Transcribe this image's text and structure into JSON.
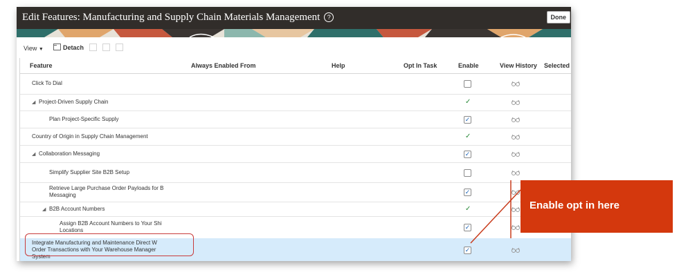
{
  "window": {
    "title": "Edit Features: Manufacturing and Supply Chain Materials Management",
    "help_glyph": "?",
    "done_label": "Done"
  },
  "toolbar": {
    "view_label": "View",
    "view_arrow": "▼",
    "detach_label": "Detach"
  },
  "columns": {
    "feature": "Feature",
    "always_enabled_from": "Always Enabled From",
    "help": "Help",
    "opt_in_task": "Opt In Task",
    "enable": "Enable",
    "view_history": "View History",
    "selected": "Selected C"
  },
  "rows": [
    {
      "label": "Click To Dial",
      "level": 0,
      "expander": "",
      "enable": "unchecked"
    },
    {
      "label": "Project-Driven Supply Chain",
      "level": 0,
      "expander": "◢",
      "enable": "tick"
    },
    {
      "label": "Plan Project-Specific Supply",
      "level": 1,
      "expander": "",
      "enable": "checked"
    },
    {
      "label": "Country of Origin in Supply Chain Management",
      "level": 0,
      "expander": "",
      "enable": "tick"
    },
    {
      "label": "Collaboration Messaging",
      "level": 0,
      "expander": "◢",
      "enable": "checked"
    },
    {
      "label": "Simplify Supplier Site B2B Setup",
      "level": 1,
      "expander": "",
      "enable": "unchecked"
    },
    {
      "label": "Retrieve Large Purchase Order Payloads for B\nMessaging",
      "level": 1,
      "expander": "",
      "enable": "checked"
    },
    {
      "label": "B2B Account Numbers",
      "level": 1,
      "expander": "◢",
      "enable": "tick"
    },
    {
      "label": "Assign B2B Account Numbers to Your Shi\nLocations",
      "level": 2,
      "expander": "",
      "enable": "checked"
    },
    {
      "label": "Integrate Manufacturing and Maintenance Direct W\nOrder Transactions with Your Warehouse Manager\nSystem",
      "level": 0,
      "expander": "",
      "enable": "checked",
      "selected": true
    }
  ],
  "glyphs": {
    "check": "✓",
    "tick": "✓"
  },
  "callout": {
    "text": "Enable opt in here"
  },
  "colors": {
    "titlebar": "#312d2a",
    "callout": "#d4380d",
    "selected_row": "#d6ebfb",
    "checkbox_check": "#1a63b8",
    "tick": "#2a8a3a"
  }
}
